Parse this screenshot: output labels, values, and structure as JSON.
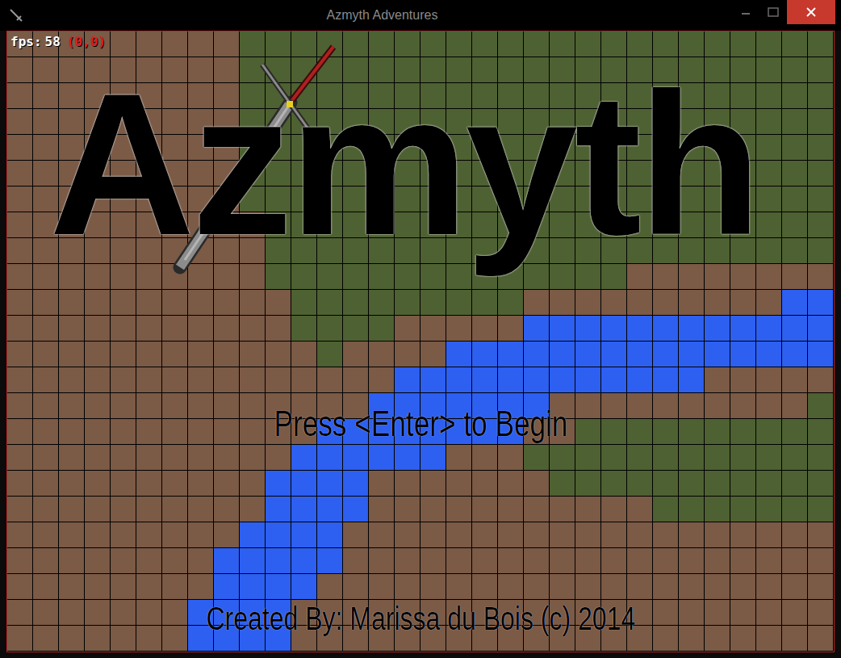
{
  "window": {
    "title": "Azmyth Adventures"
  },
  "hud": {
    "fps_label": "fps:",
    "fps": "58",
    "coords": "(0,0)"
  },
  "logo": "Azmyth",
  "prompt": "Press <Enter> to Begin",
  "credits": "Created By: Marissa du Bois (c) 2014",
  "map": {
    "rows": [
      [
        {
          "kind": "dirt",
          "count": 9
        },
        {
          "kind": "grass",
          "count": 23
        }
      ],
      [
        {
          "kind": "dirt",
          "count": 9
        },
        {
          "kind": "grass",
          "count": 23
        }
      ],
      [
        {
          "kind": "dirt",
          "count": 9
        },
        {
          "kind": "grass",
          "count": 23
        }
      ],
      [
        {
          "kind": "dirt",
          "count": 9
        },
        {
          "kind": "grass",
          "count": 23
        }
      ],
      [
        {
          "kind": "dirt",
          "count": 9
        },
        {
          "kind": "grass",
          "count": 23
        }
      ],
      [
        {
          "kind": "dirt",
          "count": 9
        },
        {
          "kind": "grass",
          "count": 23
        }
      ],
      [
        {
          "kind": "dirt",
          "count": 9
        },
        {
          "kind": "grass",
          "count": 23
        }
      ],
      [
        {
          "kind": "dirt",
          "count": 10
        },
        {
          "kind": "grass",
          "count": 22
        }
      ],
      [
        {
          "kind": "dirt",
          "count": 10
        },
        {
          "kind": "grass",
          "count": 22
        }
      ],
      [
        {
          "kind": "dirt",
          "count": 10
        },
        {
          "kind": "grass",
          "count": 14
        },
        {
          "kind": "dirt",
          "count": 8
        }
      ],
      [
        {
          "kind": "dirt",
          "count": 11
        },
        {
          "kind": "grass",
          "count": 9
        },
        {
          "kind": "dirt",
          "count": 10
        },
        {
          "kind": "water",
          "count": 2
        }
      ],
      [
        {
          "kind": "dirt",
          "count": 11
        },
        {
          "kind": "grass",
          "count": 4
        },
        {
          "kind": "dirt",
          "count": 5
        },
        {
          "kind": "water",
          "count": 12
        }
      ],
      [
        {
          "kind": "dirt",
          "count": 12
        },
        {
          "kind": "grass",
          "count": 1
        },
        {
          "kind": "dirt",
          "count": 4
        },
        {
          "kind": "water",
          "count": 15
        }
      ],
      [
        {
          "kind": "dirt",
          "count": 15
        },
        {
          "kind": "water",
          "count": 12
        },
        {
          "kind": "dirt",
          "count": 5
        }
      ],
      [
        {
          "kind": "dirt",
          "count": 14
        },
        {
          "kind": "water",
          "count": 7
        },
        {
          "kind": "dirt",
          "count": 10
        },
        {
          "kind": "grass",
          "count": 1
        }
      ],
      [
        {
          "kind": "dirt",
          "count": 12
        },
        {
          "kind": "water",
          "count": 8
        },
        {
          "kind": "dirt",
          "count": 2
        },
        {
          "kind": "grass",
          "count": 10
        }
      ],
      [
        {
          "kind": "dirt",
          "count": 11
        },
        {
          "kind": "water",
          "count": 6
        },
        {
          "kind": "dirt",
          "count": 3
        },
        {
          "kind": "grass",
          "count": 12
        }
      ],
      [
        {
          "kind": "dirt",
          "count": 10
        },
        {
          "kind": "water",
          "count": 4
        },
        {
          "kind": "dirt",
          "count": 7
        },
        {
          "kind": "grass",
          "count": 11
        }
      ],
      [
        {
          "kind": "dirt",
          "count": 10
        },
        {
          "kind": "water",
          "count": 4
        },
        {
          "kind": "dirt",
          "count": 11
        },
        {
          "kind": "grass",
          "count": 7
        }
      ],
      [
        {
          "kind": "dirt",
          "count": 9
        },
        {
          "kind": "water",
          "count": 4
        },
        {
          "kind": "dirt",
          "count": 19
        }
      ],
      [
        {
          "kind": "dirt",
          "count": 8
        },
        {
          "kind": "water",
          "count": 5
        },
        {
          "kind": "dirt",
          "count": 19
        }
      ],
      [
        {
          "kind": "dirt",
          "count": 8
        },
        {
          "kind": "water",
          "count": 4
        },
        {
          "kind": "dirt",
          "count": 20
        }
      ],
      [
        {
          "kind": "dirt",
          "count": 7
        },
        {
          "kind": "water",
          "count": 4
        },
        {
          "kind": "dirt",
          "count": 21
        }
      ],
      [
        {
          "kind": "dirt",
          "count": 7
        },
        {
          "kind": "water",
          "count": 4
        },
        {
          "kind": "dirt",
          "count": 21
        }
      ]
    ]
  }
}
